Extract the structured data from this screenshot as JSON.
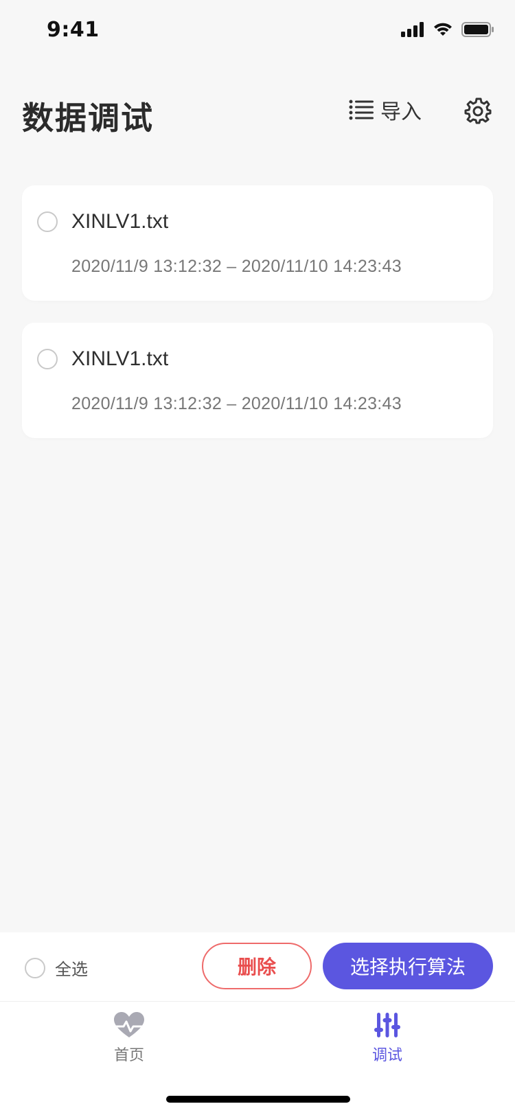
{
  "status_bar": {
    "time": "9:41"
  },
  "header": {
    "title": "数据调试",
    "import_label": "导入"
  },
  "files": [
    {
      "name": "XINLV1.txt",
      "range": "2020/11/9 13:12:32 – 2020/11/10 14:23:43"
    },
    {
      "name": "XINLV1.txt",
      "range": "2020/11/9 13:12:32 – 2020/11/10 14:23:43"
    }
  ],
  "actions": {
    "select_all_label": "全选",
    "delete_label": "删除",
    "run_label": "选择执行算法"
  },
  "tabs": [
    {
      "label": "首页",
      "icon": "heart-pulse-icon",
      "active": false
    },
    {
      "label": "调试",
      "icon": "sliders-icon",
      "active": true
    }
  ],
  "colors": {
    "accent": "#5b56e0",
    "danger": "#e94e4e",
    "background": "#f7f7f7"
  }
}
